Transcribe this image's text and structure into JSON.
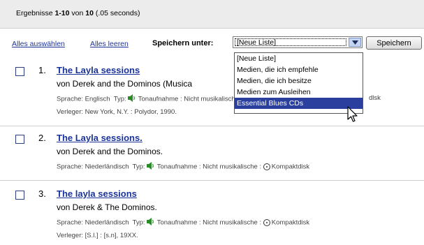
{
  "header": {
    "summary_prefix": "Ergebnisse",
    "range": "1-10",
    "of_word": "von",
    "total": "10",
    "time": "(.05 seconds)"
  },
  "toolbar": {
    "select_all": "Alles auswählen",
    "clear_all": "Alles leeren",
    "save_under_label": "Speichern unter:",
    "selected_list": "[Neue Liste]",
    "save_button": "Speichern"
  },
  "dropdown": {
    "options": [
      "[Neue Liste]",
      "Medien, die ich empfehle",
      "Medien, die ich besitze",
      "Medien zum Ausleihen",
      "Essential Blues CDs"
    ],
    "highlighted_index": 4
  },
  "results": [
    {
      "num": "1.",
      "title": "The Layla sessions",
      "author": "von Derek and the Dominos (Musica",
      "meta_lang": "Sprache: Englisch",
      "meta_type": "Typ:",
      "meta_kind": "Tonaufnahme : Nicht musikalische :",
      "meta_format": "Kompaktdisk",
      "publisher": "Verleger: New York, N.Y. : Polydor, 1990."
    },
    {
      "num": "2.",
      "title": "The Layla sessions.",
      "author": "von Derek and the Dominos.",
      "meta_lang": "Sprache: Niederländisch",
      "meta_type": "Typ:",
      "meta_kind": "Tonaufnahme : Nicht musikalische :",
      "meta_format": "Kompaktdisk"
    },
    {
      "num": "3.",
      "title": "The layla sessions",
      "author": "von Derek & The Dominos.",
      "meta_lang": "Sprache: Niederländisch",
      "meta_type": "Typ:",
      "meta_kind": "Tonaufnahme : Nicht musikalische :",
      "meta_format": "Kompaktdisk",
      "publisher": "Verleger: [S.l.] : [s.n], 19XX."
    }
  ]
}
